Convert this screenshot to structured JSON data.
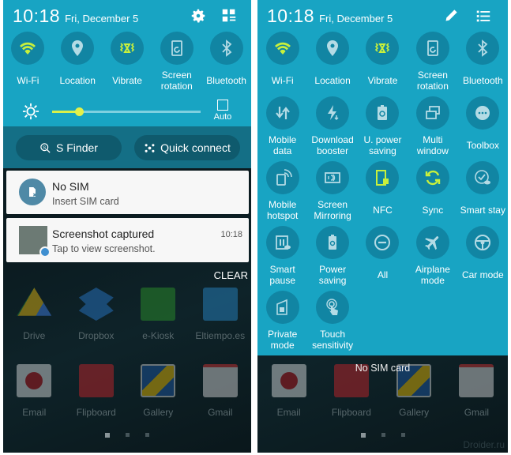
{
  "left_screen": {
    "status": {
      "time": "10:18",
      "date": "Fri, December 5"
    },
    "header_icons": [
      {
        "name": "settings-icon"
      },
      {
        "name": "edit-quick-settings-icon"
      }
    ],
    "toggles": [
      {
        "label": "Wi-Fi",
        "icon": "wifi-icon",
        "active": true
      },
      {
        "label": "Location",
        "icon": "location-icon",
        "active": false
      },
      {
        "label": "Vibrate",
        "icon": "vibrate-icon",
        "active": true
      },
      {
        "label": "Screen rotation",
        "icon": "screen-rotation-icon",
        "active": false
      },
      {
        "label": "Bluetooth",
        "icon": "bluetooth-icon",
        "active": false
      }
    ],
    "brightness": {
      "level_percent": 18,
      "auto_label": "Auto",
      "auto_checked": false
    },
    "buttons": {
      "s_finder": "S Finder",
      "quick_connect": "Quick connect"
    },
    "notifications": [
      {
        "title": "No SIM",
        "subtitle": "Insert SIM card",
        "time": ""
      },
      {
        "title": "Screenshot captured",
        "subtitle": "Tap to view screenshot.",
        "time": "10:18"
      }
    ],
    "clear_label": "CLEAR",
    "apps": [
      {
        "label": "Drive"
      },
      {
        "label": "Dropbox"
      },
      {
        "label": "e-Kiosk"
      },
      {
        "label": "Eltiempo.es"
      },
      {
        "label": "Email"
      },
      {
        "label": "Flipboard"
      },
      {
        "label": "Gallery"
      },
      {
        "label": "Gmail"
      }
    ],
    "page_indicator": {
      "pages": 3,
      "current": 1
    }
  },
  "right_screen": {
    "status": {
      "time": "10:18",
      "date": "Fri, December 5"
    },
    "header_icons": [
      {
        "name": "edit-pencil-icon"
      },
      {
        "name": "list-view-icon"
      }
    ],
    "toggles": [
      {
        "label": "Wi-Fi",
        "active": true
      },
      {
        "label": "Location",
        "active": false
      },
      {
        "label": "Vibrate",
        "active": true
      },
      {
        "label": "Screen rotation",
        "active": false
      },
      {
        "label": "Bluetooth",
        "active": false
      },
      {
        "label": "Mobile data",
        "active": false
      },
      {
        "label": "Download booster",
        "active": false
      },
      {
        "label": "U. power saving",
        "active": false
      },
      {
        "label": "Multi window",
        "active": false
      },
      {
        "label": "Toolbox",
        "active": false
      },
      {
        "label": "Mobile hotspot",
        "active": false
      },
      {
        "label": "Screen Mirroring",
        "active": false
      },
      {
        "label": "NFC",
        "active": true
      },
      {
        "label": "Sync",
        "active": true
      },
      {
        "label": "Smart stay",
        "active": false
      },
      {
        "label": "Smart pause",
        "active": false
      },
      {
        "label": "Power saving",
        "active": false
      },
      {
        "label": "All",
        "active": false
      },
      {
        "label": "Airplane mode",
        "active": false
      },
      {
        "label": "Car mode",
        "active": false
      },
      {
        "label": "Private mode",
        "active": false
      },
      {
        "label": "Touch sensitivity",
        "active": false
      }
    ],
    "carrier_text": "No SIM card",
    "apps": [
      {
        "label": "Email"
      },
      {
        "label": "Flipboard"
      },
      {
        "label": "Gallery"
      },
      {
        "label": "Gmail"
      }
    ],
    "page_indicator": {
      "pages": 3,
      "current": 1
    }
  },
  "watermark": "Droider.ru",
  "colors": {
    "panel": "#18a4c3",
    "toggle_bg": "#1185a3",
    "active": "#c8f03c",
    "inactive": "#b4dbe5"
  }
}
